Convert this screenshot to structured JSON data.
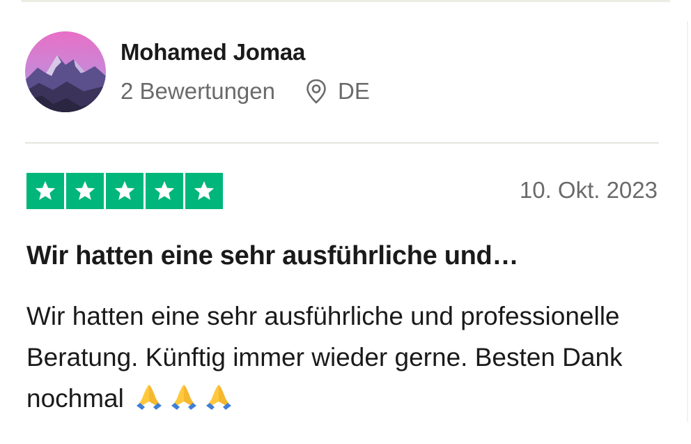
{
  "reviewer": {
    "name": "Mohamed Jomaa",
    "reviews_count": "2 Bewertungen",
    "country": "DE"
  },
  "review": {
    "rating": 5,
    "rating_max": 5,
    "date": "10. Okt. 2023",
    "title": "Wir hatten eine sehr ausführliche und…",
    "body": "Wir hatten eine sehr ausführliche und professionelle Beratung. Künftig immer wieder gerne. Besten Dank nochmal",
    "emojis": [
      "folded-hands",
      "folded-hands",
      "folded-hands"
    ]
  },
  "colors": {
    "star_bg": "#00b67a",
    "divider": "#e5e5dd",
    "muted_text": "#6a6a6a"
  }
}
